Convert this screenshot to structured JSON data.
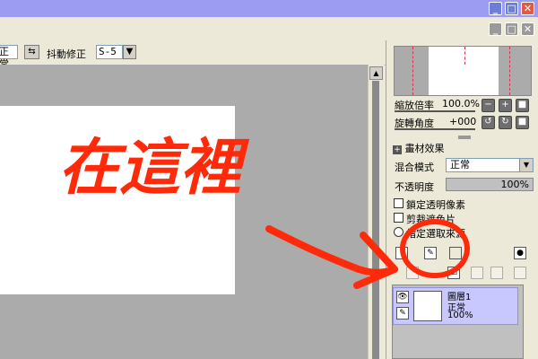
{
  "titlebar": {
    "window_buttons": [
      "minimize",
      "restore",
      "close"
    ],
    "doc_buttons": [
      "minimize",
      "restore",
      "close"
    ]
  },
  "toolbar": {
    "mode_value": "正常",
    "stabilizer_label": "抖動修正",
    "stabilizer_value": "S-5"
  },
  "navigator": {
    "zoom_label": "縮放倍率",
    "zoom_value": "100.0%",
    "rotate_label": "旋轉角度",
    "rotate_value": "+000"
  },
  "layer_props": {
    "paper_texture_label": "畫材效果",
    "blend_mode_label": "混合模式",
    "blend_mode_value": "正常",
    "opacity_label": "不透明度",
    "opacity_value": "100%",
    "lock_alpha_label": "鎖定透明像素",
    "clipping_label": "剪裁遮色片",
    "selection_source_label": "指定選取來源"
  },
  "layers": [
    {
      "name": "圖層1",
      "mode": "正常",
      "opacity": "100%"
    }
  ],
  "annotation": {
    "text": "在這裡",
    "color": "#ff2a0a"
  },
  "colors": {
    "titlebar": "#9c9cf2",
    "canvas_bg": "#ababab",
    "layer_selected": "#c8c8ff"
  }
}
